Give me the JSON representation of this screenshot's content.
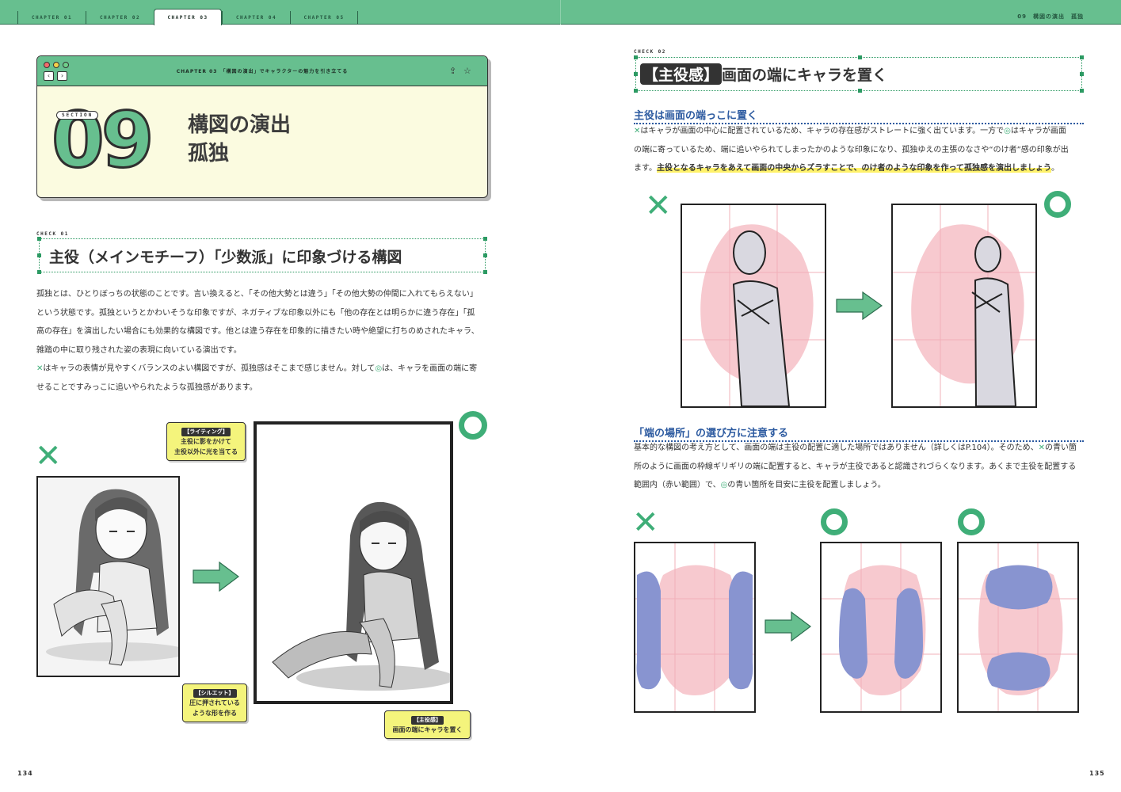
{
  "header": {
    "tabs": [
      {
        "label": "CHAPTER 01"
      },
      {
        "label": "CHAPTER 02"
      },
      {
        "label": "CHAPTER 03"
      },
      {
        "label": "CHAPTER 04"
      },
      {
        "label": "CHAPTER 05"
      }
    ],
    "running_head": "09　構図の演出　孤独"
  },
  "card": {
    "bar_title": "CHAPTER 03　「構図の演出」でキャラクターの魅力を引き立てる",
    "section_label": "SECTION",
    "section_number": "09",
    "title_line1": "構図の演出",
    "title_line2": "孤独"
  },
  "check1": {
    "label": "CHECK 01",
    "heading": "主役（メインモチーフ）「少数派」に印象づける構図"
  },
  "left_text": {
    "lines": [
      "孤独とは、ひとりぼっちの状態のことです。言い換えると、「その他大勢とは違う」「その他大勢の仲間に入れてもらえない」",
      "という状態です。孤独というとかわいそうな印象ですが、ネガティブな印象以外にも「他の存在とは明らかに違う存在」「孤",
      "高の存在」を演出したい場合にも効果的な構図です。他とは違う存在を印象的に描きたい時や絶望に打ちのめされたキャラ、",
      "雑踏の中に取り残された姿の表現に向いている演出です。"
    ],
    "mark_line1_a": "はキャラの表情が見やすくバランスのよい構図ですが、孤独感はそこまで感じません。対して",
    "mark_line1_b": "は、キャラを画面の端に寄",
    "mark_line2": "せることですみっこに追いやられたような孤独感があります。"
  },
  "bubbles": {
    "lighting_tag": "【ライティング】",
    "lighting_l1": "主役に影をかけて",
    "lighting_l2": "主役以外に光を当てる",
    "silhouette_tag": "【シルエット】",
    "silhouette_l1": "圧に押されている",
    "silhouette_l2": "ような形を作る",
    "lead_tag": "【主役感】",
    "lead_l1": "画面の端にキャラを置く"
  },
  "check2": {
    "label": "CHECK 02",
    "tag": "【主役感】",
    "heading": "画面の端にキャラを置く"
  },
  "right_section1": {
    "subheading": "主役は画面の端っこに置く",
    "line1_a": "はキャラが画面の中心に配置されているため、キャラの存在感がストレートに強く出ています。一方で",
    "line1_b": "はキャラが画面",
    "line2": "の端に寄っているため、端に追いやられてしまったかのような印象になり、孤独ゆえの主張のなさや“のけ者”感の印象が出",
    "line3_a": "ます。",
    "line3_highlight": "主役となるキャラをあえて画面の中央からズラすことで、のけ者のような印象を作って孤独感を演出しましょう",
    "line3_b": "。"
  },
  "right_section2": {
    "subheading": "「端の場所」の選び方に注意する",
    "line1_a": "基本的な構図の考え方として、画面の端は主役の配置に適した場所ではありません（詳しくはP.104）。そのため、",
    "line1_b": "の青い箇",
    "line2": "所のように画面の枠線ギリギリの端に配置すると、キャラが主役であると認識されづらくなります。あくまで主役を配置する",
    "line3_a": "範囲内（赤い範囲）で、",
    "line3_b": "の青い箇所を目安に主役を配置しましょう。"
  },
  "marks": {
    "x": "✕"
  },
  "colors": {
    "accent_green": "#67bf8f",
    "mark_green": "#3fae78",
    "card_bg": "#fbfbe0",
    "pink_zone": "#f7c9cf",
    "blue_zone": "#8894d0",
    "subheading_blue": "#2c5aa0",
    "bubble_yellow": "#f4f47c"
  },
  "page_numbers": {
    "left": "134",
    "right": "135"
  }
}
